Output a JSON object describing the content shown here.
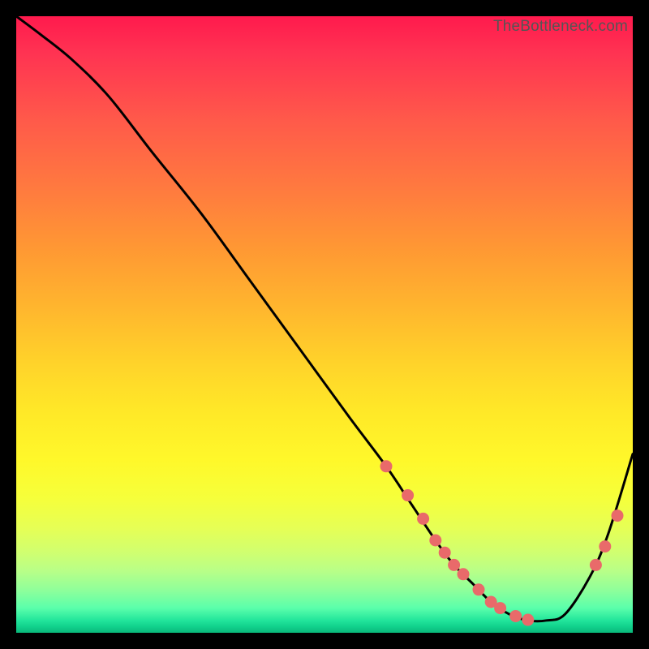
{
  "watermark": "TheBottleneck.com",
  "chart_data": {
    "type": "line",
    "title": "",
    "xlabel": "",
    "ylabel": "",
    "xlim": [
      0,
      100
    ],
    "ylim": [
      0,
      100
    ],
    "series": [
      {
        "name": "bottleneck-curve",
        "x": [
          0,
          4,
          9,
          15,
          22,
          30,
          38,
          46,
          54,
          60,
          64,
          68,
          71,
          74,
          77,
          80,
          83,
          86,
          89,
          93,
          96,
          100
        ],
        "y": [
          100,
          97,
          93,
          87,
          78,
          68,
          57,
          46,
          35,
          27,
          21,
          15,
          11,
          8,
          5,
          3,
          2,
          2,
          3,
          9,
          16,
          29
        ]
      }
    ],
    "markers": {
      "name": "highlight-dots",
      "color": "#e96a6a",
      "x": [
        60,
        63.5,
        66,
        68,
        69.5,
        71,
        72.5,
        75,
        77,
        78.5,
        81,
        83,
        94,
        95.5,
        97.5
      ],
      "y": [
        27,
        22.3,
        18.5,
        15,
        13,
        11,
        9.5,
        7,
        5,
        4,
        2.7,
        2.1,
        11,
        14,
        19
      ]
    }
  }
}
